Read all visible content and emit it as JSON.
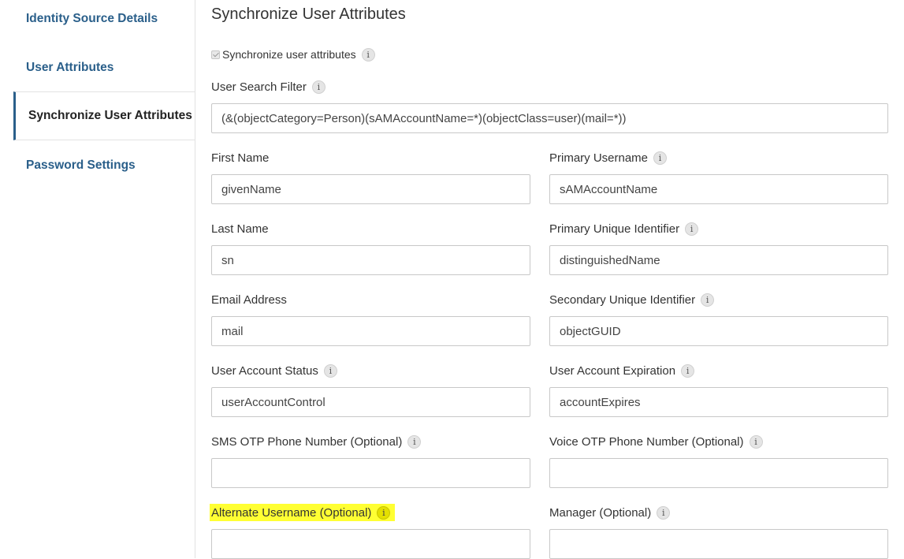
{
  "sidebar": {
    "items": [
      {
        "label": "Identity Source Details"
      },
      {
        "label": "User Attributes"
      },
      {
        "label": "Synchronize User Attributes"
      },
      {
        "label": "Password Settings"
      }
    ]
  },
  "main": {
    "title": "Synchronize User Attributes",
    "sync_checkbox": {
      "label": "Synchronize user attributes",
      "checked": true
    },
    "search_filter": {
      "label": "User Search Filter",
      "value": "(&(objectCategory=Person)(sAMAccountName=*)(objectClass=user)(mail=*))"
    },
    "first_name": {
      "label": "First Name",
      "value": "givenName"
    },
    "primary_username": {
      "label": "Primary Username",
      "value": "sAMAccountName"
    },
    "last_name": {
      "label": "Last Name",
      "value": "sn"
    },
    "primary_unique_identifier": {
      "label": "Primary Unique Identifier",
      "value": "distinguishedName"
    },
    "email_address": {
      "label": "Email Address",
      "value": "mail"
    },
    "secondary_unique_identifier": {
      "label": "Secondary Unique Identifier",
      "value": "objectGUID"
    },
    "user_account_status": {
      "label": "User Account Status",
      "value": "userAccountControl"
    },
    "user_account_expiration": {
      "label": "User Account Expiration",
      "value": "accountExpires"
    },
    "sms_otp": {
      "label": "SMS OTP Phone Number (Optional)",
      "value": ""
    },
    "voice_otp": {
      "label": "Voice OTP Phone Number (Optional)",
      "value": ""
    },
    "alternate_username": {
      "label": "Alternate Username (Optional)",
      "value": ""
    },
    "manager": {
      "label": "Manager (Optional)",
      "value": ""
    }
  },
  "info_glyph": "i",
  "colors": {
    "nav_link": "#2a5f8a",
    "highlight": "#ffff33"
  }
}
